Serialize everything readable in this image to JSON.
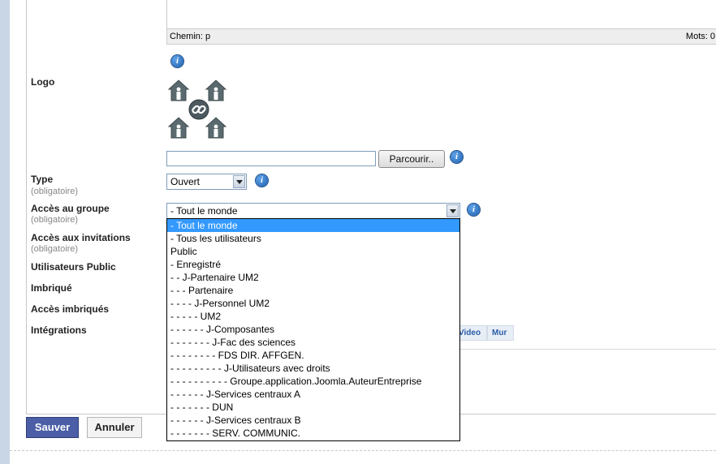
{
  "editor": {
    "path_label": "Chemin: p",
    "words_label": "Mots: 0"
  },
  "fields": {
    "logo": "Logo",
    "type": "Type",
    "type_req": "(obligatoire)",
    "acces_groupe": "Accès au groupe",
    "acces_groupe_req": "(obligatoire)",
    "acces_invitations": "Accès aux invitations",
    "acces_invitations_req": "(obligatoire)",
    "utilisateurs_public": "Utilisateurs Public",
    "imbrique": "Imbriqué",
    "acces_imbriques": "Accès imbriqués",
    "integrations": "Intégrations"
  },
  "file": {
    "browse_label": "Parcourir..",
    "value": ""
  },
  "type_select": {
    "value": "Ouvert"
  },
  "acces_select": {
    "value": "- Tout le monde"
  },
  "integration_tabs": [
    "Video",
    "Mur"
  ],
  "dropdown_options": [
    "- Tout le monde",
    "- Tous les utilisateurs",
    "Public",
    "- Enregistré",
    "- - J-Partenaire UM2",
    "- - - Partenaire",
    "- - - - J-Personnel UM2",
    "- - - - - UM2",
    "- - - - - - J-Composantes",
    "- - - - - - - J-Fac des sciences",
    "- - - - - - - - FDS DIR. AFFGEN.",
    "- - - - - - - - - J-Utilisateurs avec droits",
    "- - - - - - - - - - Groupe.application.Joomla.AuteurEntreprise",
    "- - - - - - J-Services centraux A",
    "- - - - - - - DUN",
    "- - - - - - J-Services centraux B",
    "- - - - - - - SERV. COMMUNIC."
  ],
  "dropdown_selected_index": 0,
  "buttons": {
    "save": "Sauver",
    "cancel": "Annuler"
  },
  "colors": {
    "accent": "#4b5ea6",
    "selection": "#3399ff",
    "info_icon": "#1f5fae"
  },
  "icons": [
    "info-icon",
    "group-logo-icon",
    "chevron-down-icon"
  ]
}
